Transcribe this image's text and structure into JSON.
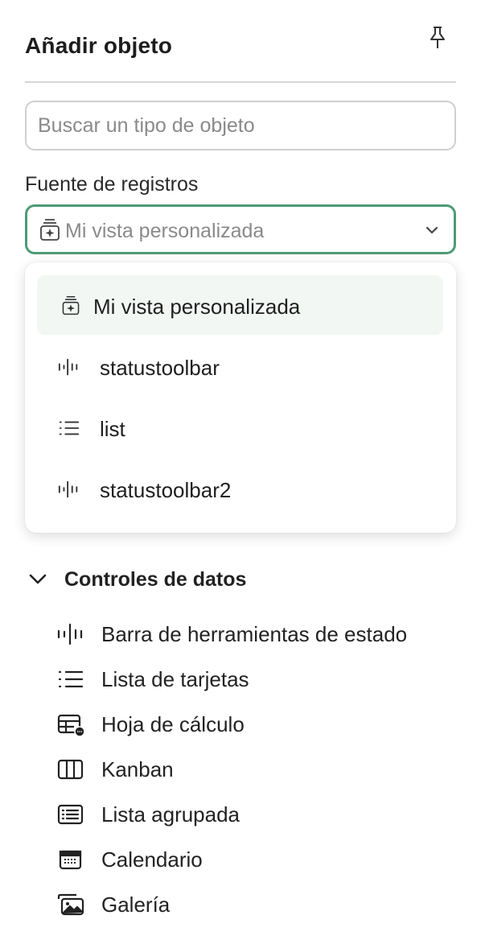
{
  "panel": {
    "title": "Añadir objeto",
    "pin_icon": "pin-icon"
  },
  "search": {
    "placeholder": "Buscar un tipo de objeto",
    "value": ""
  },
  "source": {
    "label": "Fuente de registros",
    "selected": "Mi vista personalizada",
    "selected_icon": "custom-view-icon",
    "accent_color": "#4e9a76",
    "options": [
      {
        "label": "Mi vista personalizada",
        "icon": "custom-view-icon",
        "selected": true
      },
      {
        "label": "statustoolbar",
        "icon": "status-toolbar-icon"
      },
      {
        "label": "list",
        "icon": "list-icon"
      },
      {
        "label": "statustoolbar2",
        "icon": "status-toolbar-icon"
      }
    ]
  },
  "data_controls": {
    "title": "Controles de datos",
    "expanded": true,
    "items": [
      {
        "label": "Barra de herramientas de estado",
        "icon": "status-toolbar-icon"
      },
      {
        "label": "Lista de tarjetas",
        "icon": "list-icon"
      },
      {
        "label": "Hoja de cálculo",
        "icon": "spreadsheet-icon"
      },
      {
        "label": "Kanban",
        "icon": "kanban-icon"
      },
      {
        "label": "Lista agrupada",
        "icon": "grouped-list-icon"
      },
      {
        "label": "Calendario",
        "icon": "calendar-icon"
      },
      {
        "label": "Galería",
        "icon": "gallery-icon"
      }
    ]
  }
}
